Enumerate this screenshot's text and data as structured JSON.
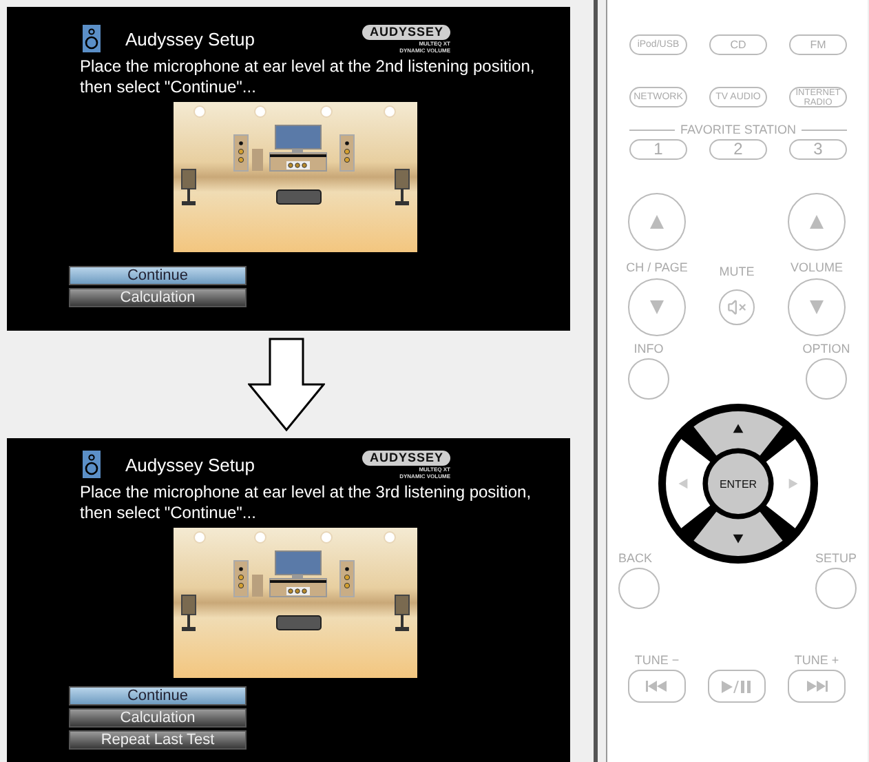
{
  "screens": [
    {
      "title": "Audyssey Setup",
      "logo": {
        "brand": "AUDYSSEY",
        "lines": [
          "MULTEQ XT",
          "DYNAMIC VOLUME"
        ]
      },
      "message": "Place the microphone at ear level at the 2nd listening position, then select \"Continue\"...",
      "buttons": [
        {
          "label": "Continue",
          "selected": true
        },
        {
          "label": "Calculation",
          "selected": false
        }
      ]
    },
    {
      "title": "Audyssey Setup",
      "logo": {
        "brand": "AUDYSSEY",
        "lines": [
          "MULTEQ XT",
          "DYNAMIC VOLUME"
        ]
      },
      "message": "Place the microphone at ear level at the 3rd listening position, then select \"Continue\"...",
      "buttons": [
        {
          "label": "Continue",
          "selected": true
        },
        {
          "label": "Calculation",
          "selected": false
        },
        {
          "label": "Repeat Last Test",
          "selected": false
        }
      ]
    }
  ],
  "remote": {
    "source_buttons": [
      {
        "label": "iPod/USB"
      },
      {
        "label": "CD"
      },
      {
        "label": "FM"
      },
      {
        "label": "NETWORK"
      },
      {
        "label": "TV AUDIO"
      },
      {
        "label": "INTERNET RADIO"
      }
    ],
    "favorite_label": "FAVORITE STATION",
    "favorite_buttons": [
      "1",
      "2",
      "3"
    ],
    "ch_label": "CH / PAGE",
    "mute_label": "MUTE",
    "volume_label": "VOLUME",
    "info_label": "INFO",
    "option_label": "OPTION",
    "enter_label": "ENTER",
    "dpad": [
      {
        "kind": "up",
        "highlighted": true
      },
      {
        "kind": "left",
        "highlighted": false
      },
      {
        "kind": "right",
        "highlighted": false
      },
      {
        "kind": "down",
        "highlighted": true
      }
    ],
    "back_label": "BACK",
    "setup_label": "SETUP",
    "tune_minus_label": "TUNE −",
    "tune_plus_label": "TUNE +"
  }
}
